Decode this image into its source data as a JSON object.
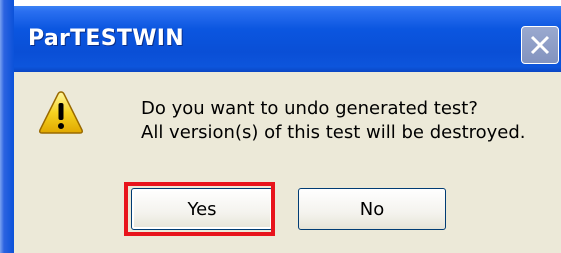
{
  "window": {
    "title": "ParTESTWIN",
    "close_icon": "close-x-icon"
  },
  "dialog": {
    "icon": "warning-icon",
    "message_line1": "Do you want to undo generated test?",
    "message_line2": "All version(s) of this test will be destroyed."
  },
  "buttons": {
    "yes_label": "Yes",
    "no_label": "No"
  },
  "colors": {
    "titlebar": "#0a4fd6",
    "dialog_background": "#ece9d8",
    "highlight": "#e8141c",
    "warning_yellow": "#f6d220"
  }
}
